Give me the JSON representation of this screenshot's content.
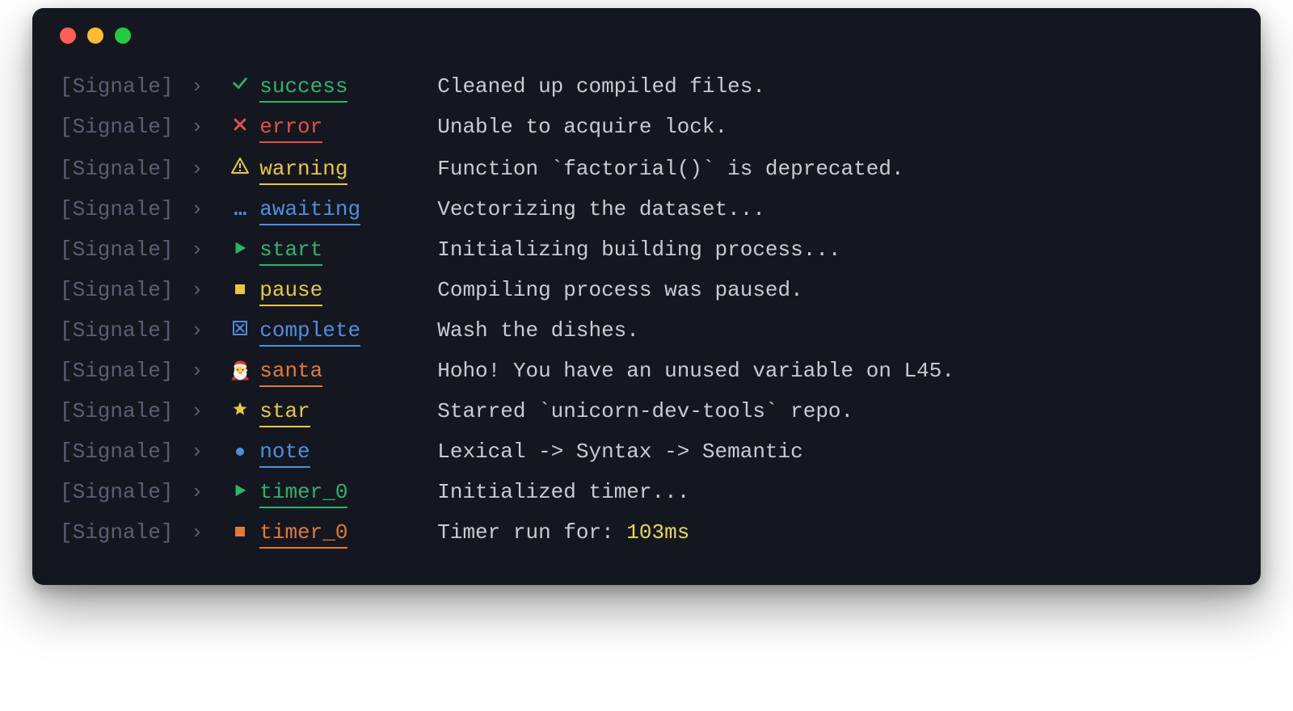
{
  "prefix": "[Signale]",
  "arrow": "›",
  "lines": [
    {
      "icon": "check",
      "color": "green",
      "label": "success",
      "message": "Cleaned up compiled files."
    },
    {
      "icon": "cross",
      "color": "red",
      "label": "error",
      "message": "Unable to acquire lock."
    },
    {
      "icon": "warn",
      "color": "yellow",
      "label": "warning",
      "message": "Function `factorial()` is deprecated."
    },
    {
      "icon": "dots",
      "color": "blue",
      "label": "awaiting",
      "message": "Vectorizing the dataset..."
    },
    {
      "icon": "play",
      "color": "green",
      "label": "start",
      "message": "Initializing building process..."
    },
    {
      "icon": "square",
      "color": "yellow",
      "label": "pause",
      "message": "Compiling process was paused."
    },
    {
      "icon": "boxx",
      "color": "blue",
      "label": "complete",
      "message": "Wash the dishes."
    },
    {
      "icon": "santa",
      "color": "orange",
      "label": "santa",
      "message": "Hoho! You have an unused variable on L45."
    },
    {
      "icon": "star",
      "color": "yellow",
      "label": "star",
      "message": "Starred `unicorn-dev-tools` repo."
    },
    {
      "icon": "dot",
      "color": "blue",
      "label": "note",
      "message": "Lexical -> Syntax -> Semantic"
    },
    {
      "icon": "play",
      "color": "green",
      "label": "timer_0",
      "message": "Initialized timer..."
    },
    {
      "icon": "squaref",
      "color": "orange",
      "label": "timer_0",
      "message": "Timer run for: ",
      "highlight": "103ms"
    }
  ],
  "colors": {
    "green": "#29b66b",
    "red": "#e2514a",
    "yellow": "#e7c93d",
    "blue": "#4f8fe0",
    "orange": "#e07a3b"
  }
}
